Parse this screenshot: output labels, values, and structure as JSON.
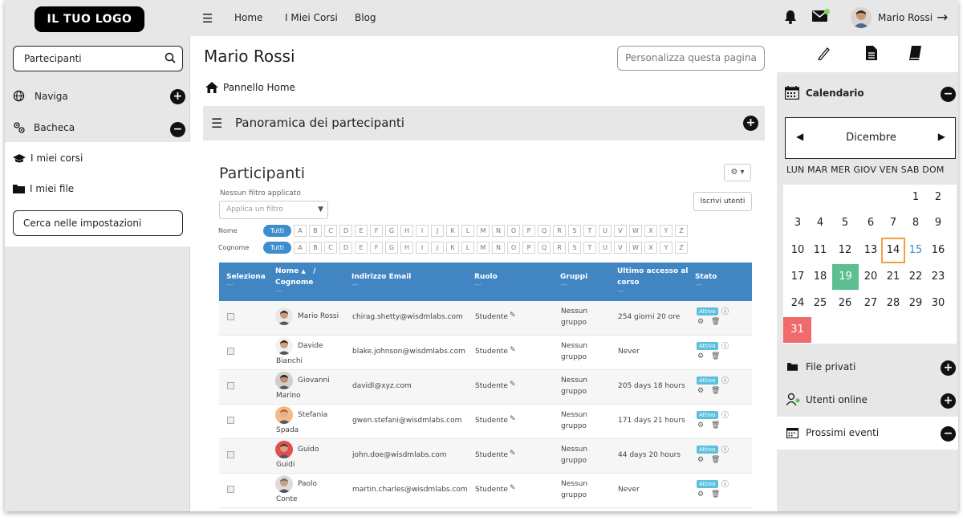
{
  "header": {
    "logo": "IL TUO LOGO",
    "nav": [
      "Home",
      "I Miei Corsi",
      "Blog"
    ],
    "user_name": "Mario Rossi"
  },
  "left": {
    "search_value": "Partecipanti",
    "items": [
      "Naviga",
      "Bacheca",
      "I miei corsi",
      "I miei file"
    ],
    "settings_button": "Cerca nelle impostazioni"
  },
  "main": {
    "title": "Mario Rossi",
    "customize": "Personalizza questa pagina",
    "breadcrumb": "Pannello Home",
    "panel_title": "Panoramica dei partecipanti",
    "participants_title": "Participanti",
    "no_filter": "Nessun filtro applicato",
    "filter_placeholder": "Applica un filtro",
    "enroll": "Iscrivi utenti",
    "first_label": "Nome",
    "last_label": "Cognome",
    "all": "Tutti",
    "letters": [
      "A",
      "B",
      "C",
      "D",
      "E",
      "F",
      "G",
      "H",
      "I",
      "J",
      "K",
      "L",
      "M",
      "N",
      "O",
      "P",
      "Q",
      "R",
      "S",
      "T",
      "U",
      "V",
      "W",
      "X",
      "Y",
      "Z"
    ],
    "columns": {
      "select": "Seleziona",
      "name": "Nome",
      "surname": "Cognome",
      "email": "Indirizzo Email",
      "role": "Ruolo",
      "groups": "Gruppi",
      "last_access": "Ultimo accesso al corso",
      "status": "Stato"
    },
    "rows": [
      {
        "first": "Mario Rossi",
        "last": "",
        "email": "chirag.shetty@wisdmlabs.com",
        "role": "Studente",
        "group1": "Nessun",
        "group2": "gruppo",
        "access": "254 giorni 20 ore",
        "status": "Attivo"
      },
      {
        "first": "Davide",
        "last": "Bianchi",
        "email": "blake.johnson@wisdmlabs.com",
        "role": "Studente",
        "group1": "Nessun",
        "group2": "gruppo",
        "access": "Never",
        "status": "Attivo"
      },
      {
        "first": "Giovanni",
        "last": "Marino",
        "email": "davidl@xyz.com",
        "role": "Studente",
        "group1": "Nessun",
        "group2": "gruppo",
        "access": "205 days 18 hours",
        "status": "Attivo"
      },
      {
        "first": "Stefania",
        "last": "Spada",
        "email": "gwen.stefani@wisdmlabs.com",
        "role": "Studente",
        "group1": "Nessun",
        "group2": "gruppo",
        "access": "171 days 21 hours",
        "status": "Attivo"
      },
      {
        "first": "Guido",
        "last": "Guidi",
        "email": "john.doe@wisdmlabs.com",
        "role": "Studente",
        "group1": "Nessun",
        "group2": "gruppo",
        "access": "44 days 20 hours",
        "status": "Attivo"
      },
      {
        "first": "Paolo",
        "last": "Conte",
        "email": "martin.charles@wisdmlabs.com",
        "role": "Studente",
        "group1": "Nessun",
        "group2": "gruppo",
        "access": "Never",
        "status": "Attivo"
      }
    ]
  },
  "right": {
    "calendar_title": "Calendario",
    "month": "Dicembre",
    "dow": "LUN MAR MER GIOV VEN SAB DOM",
    "days": [
      "1",
      "2",
      "3",
      "4",
      "5",
      "6",
      "7",
      "8",
      "9",
      "10",
      "11",
      "12",
      "13",
      "14",
      "15",
      "16",
      "17",
      "18",
      "19",
      "20",
      "21",
      "22",
      "23",
      "24",
      "25",
      "26",
      "27",
      "28",
      "29",
      "30",
      "31"
    ],
    "private_files": "File privati",
    "online_users": "Utenti online",
    "upcoming": "Prossimi eventi"
  },
  "colors": {
    "header_bg": "#e6e7e6",
    "table_head": "#4186c3",
    "accent_blue": "#3d8dcb",
    "today_border": "#f0a040",
    "event_green": "#5bbf8f",
    "event_red": "#f06b6b",
    "status_badge": "#5bc0de"
  }
}
